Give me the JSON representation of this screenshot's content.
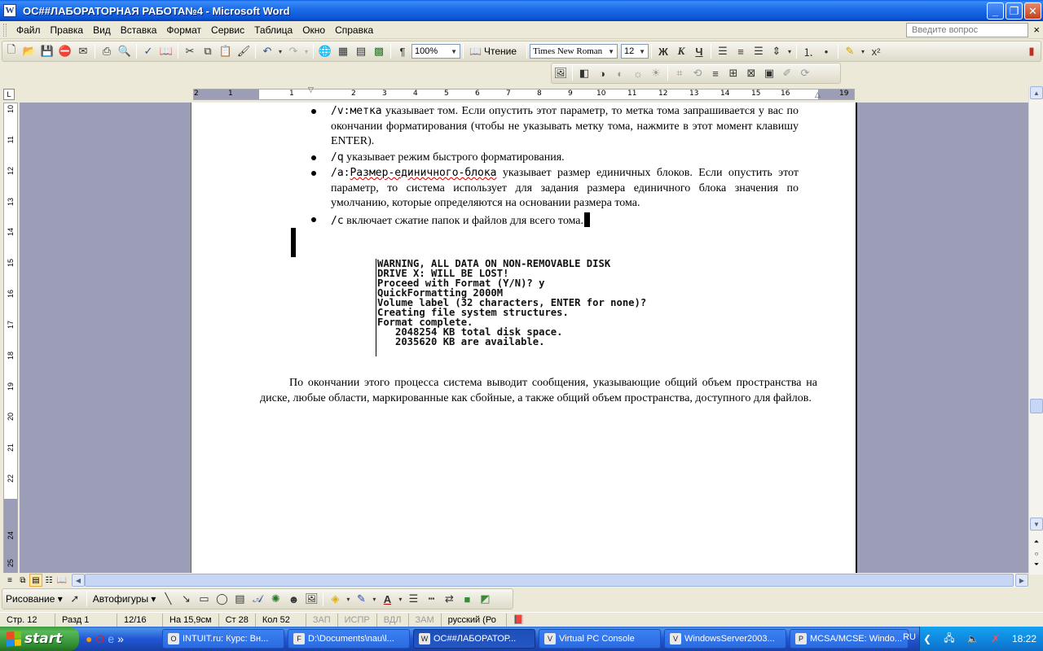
{
  "window": {
    "title": "ОС##ЛАБОРАТОРНАЯ РАБОТА№4 - Microsoft Word",
    "app_icon": "W"
  },
  "menu": {
    "items": [
      "Файл",
      "Правка",
      "Вид",
      "Вставка",
      "Формат",
      "Сервис",
      "Таблица",
      "Окно",
      "Справка"
    ],
    "help_placeholder": "Введите вопрос"
  },
  "toolbar": {
    "zoom": "100%",
    "read_label": "Чтение",
    "font_name": "Times New Roman",
    "font_size": "12",
    "bold": "Ж",
    "italic": "К",
    "underline": "Ч"
  },
  "ruler": {
    "h_labels": [
      "2",
      "1",
      "1",
      "1",
      "2",
      "3",
      "4",
      "5",
      "6",
      "7",
      "8",
      "9",
      "10",
      "11",
      "12",
      "13",
      "14",
      "15",
      "16",
      "17",
      "19"
    ],
    "v_labels": [
      "10",
      "11",
      "12",
      "13",
      "14",
      "15",
      "16",
      "17",
      "18",
      "19",
      "20",
      "21",
      "22",
      "23",
      "24",
      "25"
    ]
  },
  "document": {
    "bullets": [
      {
        "code": "/v:метка",
        "text": " указывает том. Если опустить этот параметр, то метка тома запрашивается у вас по окончании форматирования (чтобы не указывать метку тома, нажмите в этот момент клавишу ENTER)."
      },
      {
        "code": "/q",
        "text": " указывает режим быстрого форматирования."
      },
      {
        "code": "/a:",
        "code2": "Размер-единичного-блока",
        "text": " указывает размер единичных блоков. Если опустить этот параметр, то система использует для задания размера единичного блока значения по умолчанию, которые определяются на основании размера тома."
      },
      {
        "code": "/c",
        "text": " включает сжатие папок и файлов для всего тома."
      }
    ],
    "console_lines": [
      "WARNING, ALL DATA ON NON-REMOVABLE DISK",
      "DRIVE X: WILL BE LOST!",
      "Proceed with Format (Y/N)? y",
      "QuickFormatting 2000M",
      "Volume label (32 characters, ENTER for none)?",
      "Creating file system structures.",
      "Format complete.",
      "   2048254 KB total disk space.",
      "   2035620 KB are available."
    ],
    "paragraph": "По окончании этого процесса система выводит сообщения, указывающие общий объем пространства на диске, любые области, маркированные как сбойные, а также общий объем пространства, доступного для файлов."
  },
  "drawing_toolbar": {
    "draw_label": "Рисование",
    "autoshapes_label": "Автофигуры"
  },
  "status": {
    "page": "Стр. 12",
    "section": "Разд 1",
    "pages": "12/16",
    "at": "На 15,9см",
    "line": "Ст 28",
    "col": "Кол 52",
    "rec": "ЗАП",
    "trk": "ИСПР",
    "ext": "ВДЛ",
    "ovr": "ЗАМ",
    "lang": "русский (Ро"
  },
  "taskbar": {
    "start": "start",
    "tasks": [
      {
        "icon": "O",
        "label": "INTUIT.ru: Курс: Вн..."
      },
      {
        "icon": "F",
        "label": "D:\\Documents\\nau\\l..."
      },
      {
        "icon": "W",
        "label": "ОС##ЛАБОРАТОР..."
      },
      {
        "icon": "V",
        "label": "Virtual PC Console"
      },
      {
        "icon": "V",
        "label": "WindowsServer2003..."
      },
      {
        "icon": "P",
        "label": "MCSA/MCSE: Windo..."
      }
    ],
    "lang": "RU",
    "clock": "18:22"
  }
}
